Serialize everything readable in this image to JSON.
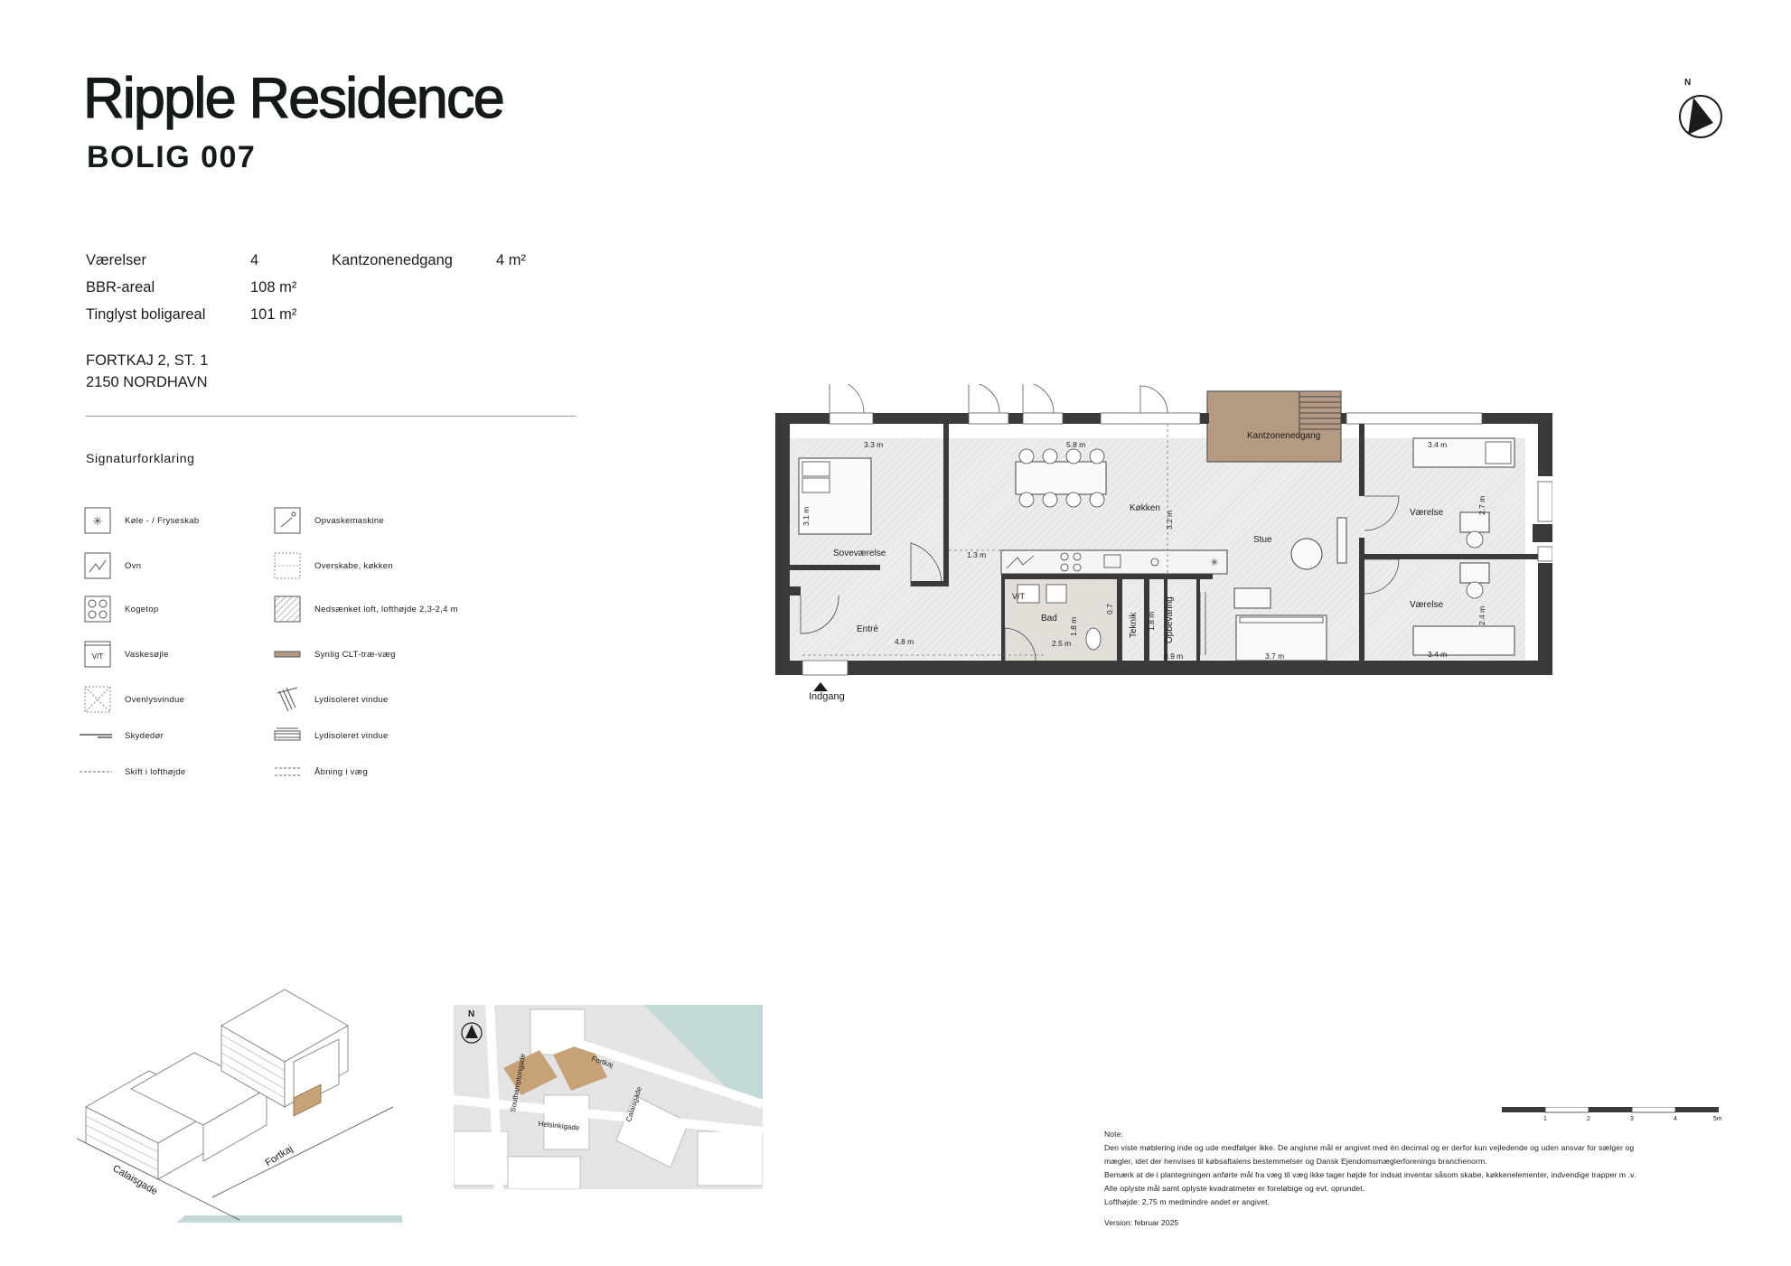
{
  "header": {
    "title": "Ripple Residence",
    "subtitle": "BOLIG 007",
    "north_label": "N"
  },
  "facts": {
    "rooms_label": "Værelser",
    "rooms_value": "4",
    "bbr_label": "BBR-areal",
    "bbr_value": "108 m²",
    "tinglyst_label": "Tinglyst boligareal",
    "tinglyst_value": "101 m²",
    "kantzone_label": "Kantzonenedgang",
    "kantzone_value": "4 m²"
  },
  "address": {
    "line1": "FORTKAJ 2, ST. 1",
    "line2": "2150 NORDHAVN"
  },
  "legend": {
    "title": "Signaturforklaring",
    "items": [
      {
        "icon": "fridge-freezer-icon",
        "label": "Køle - / Fryseskab"
      },
      {
        "icon": "dishwasher-icon",
        "label": "Opvaskemaskine"
      },
      {
        "icon": "oven-icon",
        "label": "Ovn"
      },
      {
        "icon": "upper-cabinet-icon",
        "label": "Overskabe, køkken"
      },
      {
        "icon": "cooktop-icon",
        "label": "Kogetop"
      },
      {
        "icon": "lowered-ceiling-icon",
        "label": "Nedsænket loft, lofthøjde 2,3-2,4 m"
      },
      {
        "icon": "washer-dryer-icon",
        "label": "Vaskesøjle"
      },
      {
        "icon": "clt-wall-icon",
        "label": "Synlig CLT-træ-væg"
      },
      {
        "icon": "skylight-icon",
        "label": "Ovenlysvindue"
      },
      {
        "icon": "soundproof-window-icon",
        "label": "Lydisoleret vindue"
      },
      {
        "icon": "sliding-door-icon",
        "label": "Skydedør"
      },
      {
        "icon": "soundproof-window-2-icon",
        "label": "Lydisoleret vindue"
      },
      {
        "icon": "ceiling-height-change-icon",
        "label": "Skift i lofthøjde"
      },
      {
        "icon": "wall-opening-icon",
        "label": "Åbning i væg"
      }
    ],
    "vt_text": "V/T"
  },
  "floorplan": {
    "rooms": {
      "sovevaerelse": "Soveværelse",
      "koekken": "Køkken",
      "stue": "Stue",
      "vaerelse1": "Værelse",
      "vaerelse2": "Værelse",
      "entre": "Entré",
      "bad": "Bad",
      "teknik": "Teknik",
      "opbevaring": "Opbevaring",
      "kantzone": "Kantzonenedgang",
      "vt": "V/T"
    },
    "dimensions": {
      "d_3_3": "3.3 m",
      "d_5_8": "5.8 m",
      "d_3_4_top": "3.4 m",
      "d_3_1": "3.1 m",
      "d_3_2": "3.2 m",
      "d_2_7": "2.7 m",
      "d_1_3": "1.3 m",
      "d_4_8": "4.8 m",
      "d_1_8": "1.8 m",
      "d_2_5": "2.5 m",
      "d_1_8b": "1.8 m",
      "d_0_9": "0.9 m",
      "d_3_7": "3.7 m",
      "d_2_4": "2.4 m",
      "d_3_4_bottom": "3.4 m",
      "d_0_7": "0.7"
    },
    "entrance_label": "Indgang"
  },
  "context": {
    "axon_streets": [
      "Calaisgade",
      "Fortkaj"
    ],
    "map_streets": [
      "Southamptongade",
      "Fortkaj",
      "Calaisgade",
      "Helsinkigade"
    ],
    "map_north": "N"
  },
  "scale": {
    "ticks": [
      "1",
      "2",
      "3",
      "4",
      "5m"
    ]
  },
  "notes": {
    "heading": "Note:",
    "lines": [
      "Den viste møblering inde og ude medfølger ikke. De angivne mål er angivet med én decimal og er derfor kun vejledende og uden ansvar for sælger og",
      "mægler, idet der henvises til købsaftalens bestemmelser og Dansk Ejendomsmæglerforenings branchenorm.",
      "Bemærk at de i plantegningen anførte mål fra væg til væg ikke tager højde for indsat inventar såsom skabe, køkkenelementer, indvendige trapper m .v.",
      "Alle oplyste mål samt oplyste kvadratmeter er foreløbige og evt. oprundet.",
      "Lofthøjde: 2,75 m medmindre andet er angivet."
    ],
    "version": "Version: februar 2025"
  },
  "colors": {
    "wall": "#3a3a3a",
    "clt_wood": "#b49a82",
    "building_highlight": "#c7a277",
    "water": "#c3d9d7",
    "road": "#e4e4e4"
  }
}
